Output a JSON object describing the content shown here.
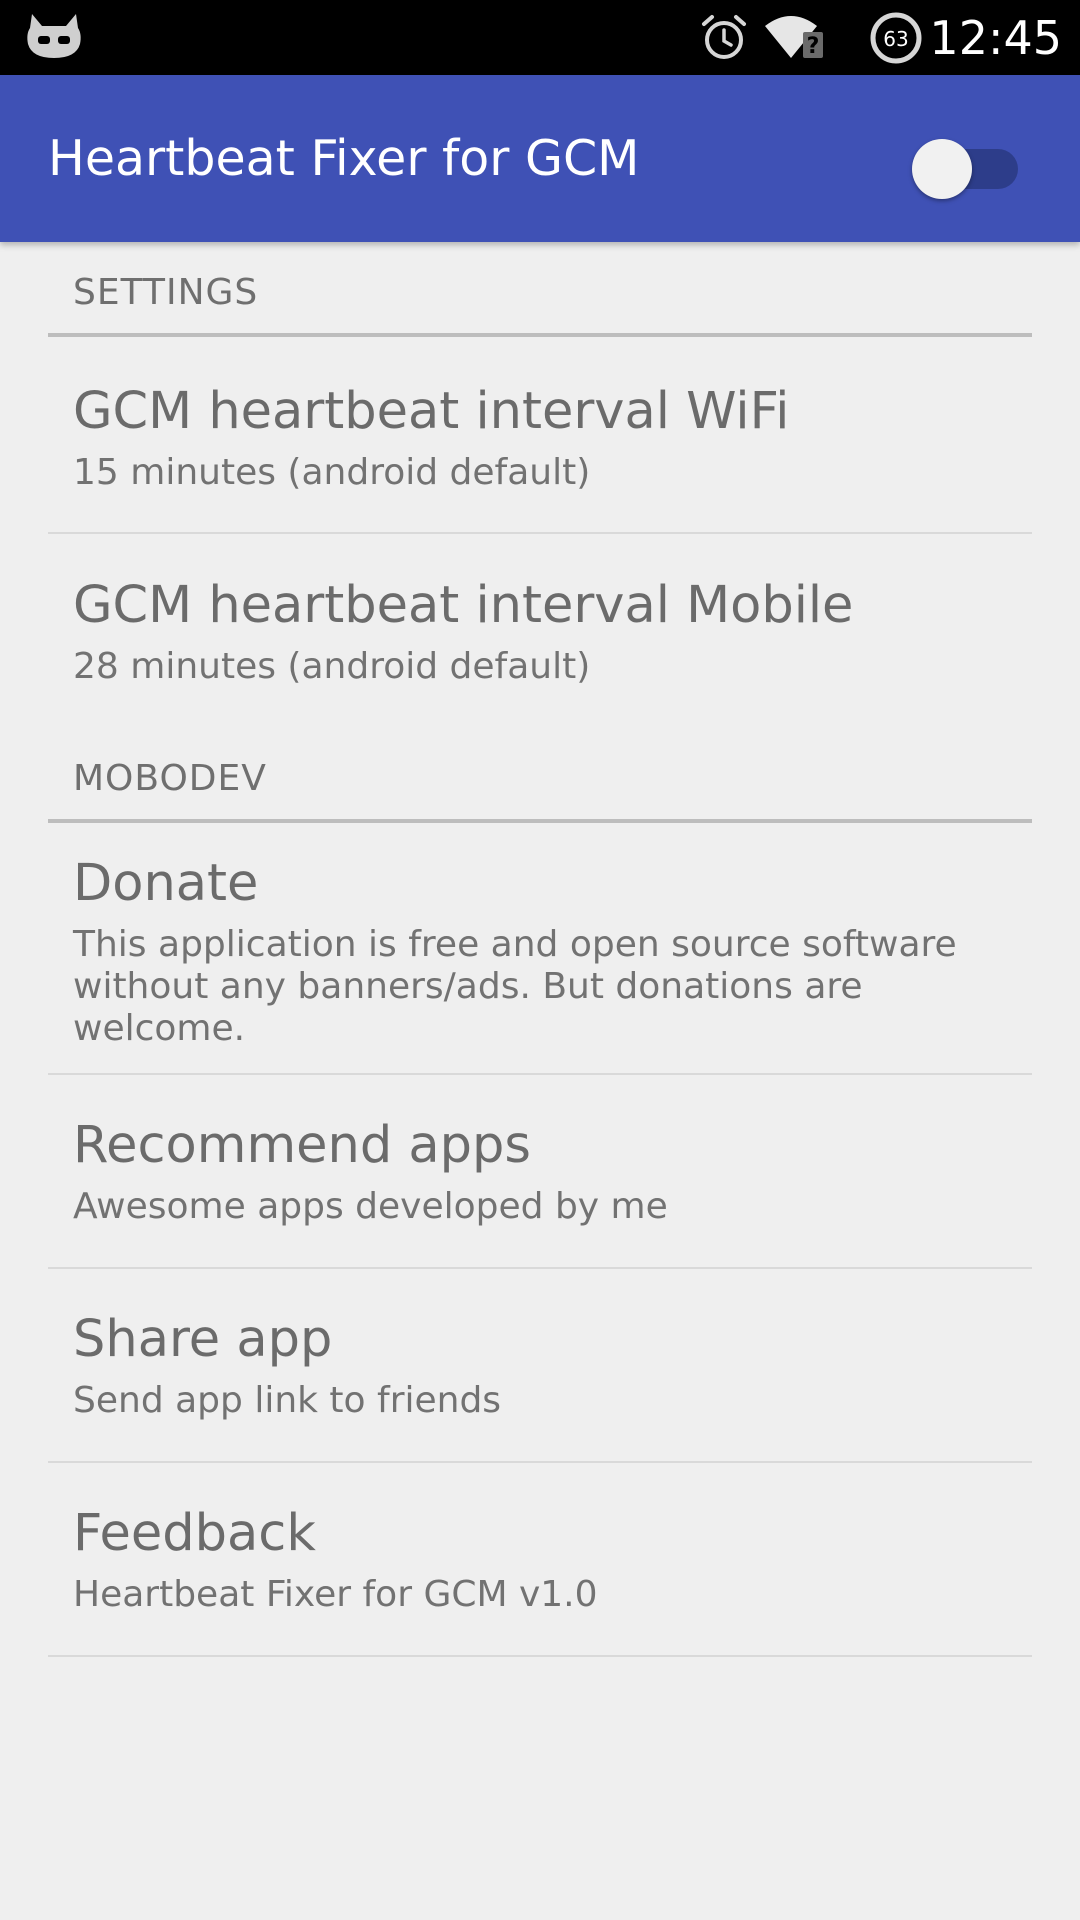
{
  "status_bar": {
    "time": "12:45",
    "battery_level": "63",
    "icons": [
      "cyanogenmod-icon",
      "alarm-icon",
      "wifi-icon",
      "no-sim-icon",
      "battery-icon"
    ]
  },
  "toolbar": {
    "title": "Heartbeat Fixer for GCM",
    "switch_on": false
  },
  "settings_category": {
    "title": "SETTINGS",
    "items": [
      {
        "title": "GCM heartbeat interval WiFi",
        "summary": "15 minutes (android default)"
      },
      {
        "title": "GCM heartbeat interval Mobile",
        "summary": "28 minutes (android default)"
      }
    ]
  },
  "mobodev_category": {
    "title": "MOBODEV",
    "items": [
      {
        "title": "Donate",
        "summary": "This application is free and open source software without any banners/ads. But donations are welcome."
      },
      {
        "title": "Recommend apps",
        "summary": "Awesome apps developed by me"
      },
      {
        "title": "Share app",
        "summary": "Send app link to friends"
      },
      {
        "title": "Feedback",
        "summary": "Heartbeat Fixer for GCM v1.0"
      }
    ]
  },
  "colors": {
    "primary": "#3f51b5",
    "primary_dark": "#2d3d8a",
    "background": "#efefef",
    "text_primary": "#6b6b6b"
  }
}
